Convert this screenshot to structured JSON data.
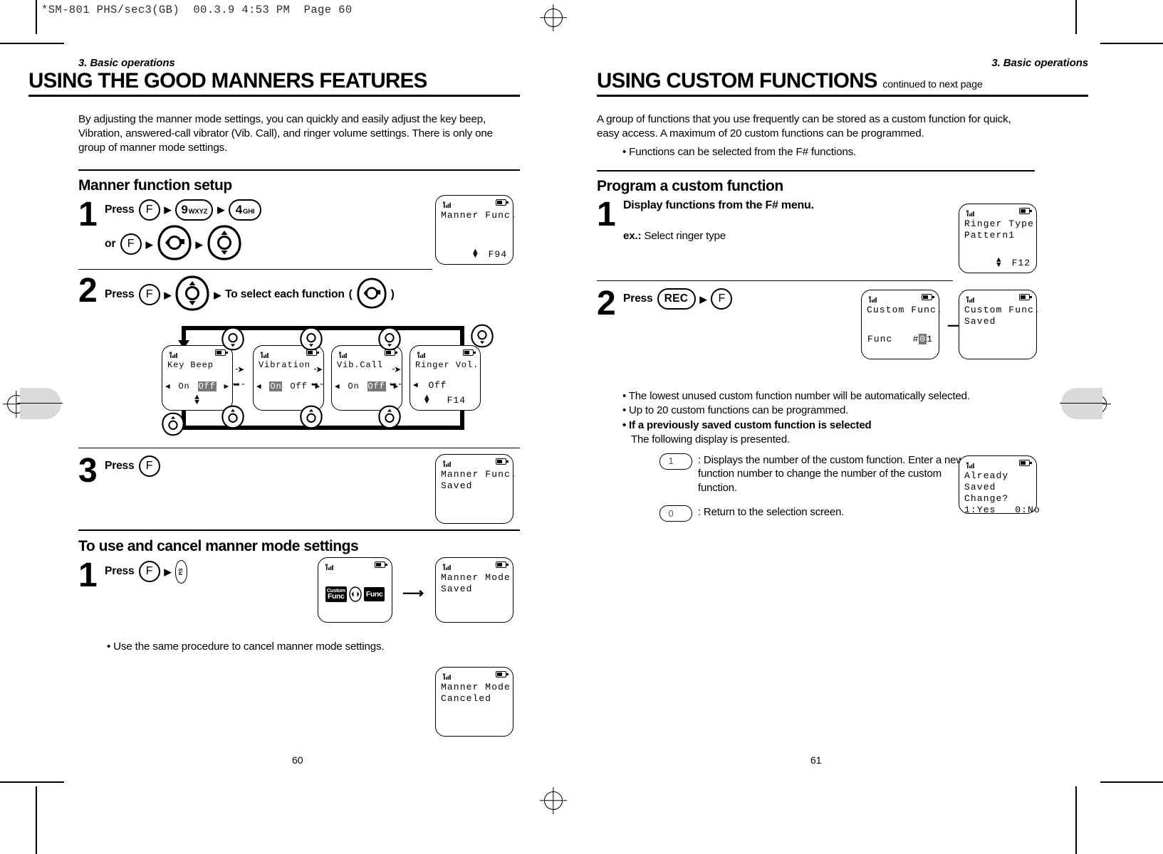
{
  "slug": "*SM-801 PHS/sec3(GB)  00.3.9 4:53 PM  Page 60",
  "left_page": {
    "section_label": "3. Basic operations",
    "title": "USING THE GOOD MANNERS FEATURES",
    "intro": "By adjusting the manner mode settings, you can quickly and easily adjust the key beep, Vibration, answered-call vibrator (Vib. Call), and ringer volume settings. There is only one group of manner mode settings.",
    "subhead_1": "Manner function setup",
    "step1": {
      "num": "1",
      "press_label": "Press",
      "or_label": "or",
      "key_f": "F",
      "key_9": "9",
      "key_9_sub": "WXYZ",
      "key_4": "4",
      "key_4_sub": "GHI",
      "lcd": {
        "line1": "Manner Func.",
        "fcode": "F94"
      }
    },
    "step2": {
      "num": "2",
      "press_label": "Press",
      "key_f": "F",
      "select_text": "To select each function",
      "paren_open": "(",
      "paren_close": ")",
      "screens": [
        {
          "title": "Key Beep",
          "opt_left": "On",
          "opt_right": "Off",
          "selected": "Off",
          "fcode": ""
        },
        {
          "title": "Vibration",
          "opt_left": "On",
          "opt_right": "Off",
          "selected": "On",
          "fcode": ""
        },
        {
          "title": "Vib.Call",
          "opt_left": "On",
          "opt_right": "Off",
          "selected": "Off",
          "fcode": ""
        },
        {
          "title": "Ringer Vol.",
          "opt_left": "Off",
          "opt_right": "",
          "selected": "",
          "fcode": "F14"
        }
      ]
    },
    "step3": {
      "num": "3",
      "press_label": "Press",
      "key_f": "F",
      "lcd": {
        "line1": "Manner Func.",
        "line2": "Saved"
      }
    },
    "subhead_2": "To use and cancel manner mode settings",
    "step4": {
      "num": "1",
      "press_label": "Press",
      "key_f": "F",
      "key_ps": "P.S",
      "lcd_icons": {
        "custom_top": "Custom",
        "custom_bottom": "Func",
        "func_label": "Func"
      },
      "lcd_saved": {
        "line1": "Manner Mode",
        "line2": "Saved"
      },
      "note": "• Use the same procedure to cancel manner mode settings.",
      "lcd_canceled": {
        "line1": "Manner Mode",
        "line2": "Canceled"
      }
    },
    "page_number": "60"
  },
  "right_page": {
    "section_label": "3. Basic operations",
    "title": "USING CUSTOM FUNCTIONS",
    "title_continued": "continued to next page",
    "intro": "A group of functions that you use frequently can be stored as a custom function for quick, easy access. A maximum of 20 custom functions can be programmed.",
    "intro_bullet": "• Functions can be selected from the F# functions.",
    "subhead_1": "Program a custom function",
    "step1": {
      "num": "1",
      "heading": "Display functions from the F# menu.",
      "ex_label": "ex.:",
      "ex_text": "Select ringer type",
      "lcd": {
        "line1": "Ringer Type",
        "line2": "Pattern1",
        "fcode": "F12"
      }
    },
    "step2": {
      "num": "2",
      "press_label": "Press",
      "key_rec": "REC",
      "key_f": "F",
      "lcd_a": {
        "line1": "Custom Func.",
        "line2_left": "Func",
        "line2_hash": "#",
        "line2_inv": "0",
        "line2_rest": "1"
      },
      "lcd_b": {
        "line1": "Custom Func.",
        "line2": "Saved"
      }
    },
    "notes": [
      "• The lowest unused custom function number will be automatically selected.",
      "• Up to 20 custom functions can be programmed."
    ],
    "note_bold": "• If a previously saved custom function is selected",
    "note_bold_sub": "The following display is presented.",
    "key_desc_1": {
      "key": "1",
      "text": ": Displays the number of the custom function. Enter a new function number to change the number of the custom function."
    },
    "key_desc_0": {
      "key": "0",
      "text": ": Return to the selection screen."
    },
    "lcd_already": {
      "line1": "Already",
      "line2": "Saved",
      "line3": "Change?",
      "line4": "1:Yes   0:No"
    },
    "page_number": "61"
  }
}
